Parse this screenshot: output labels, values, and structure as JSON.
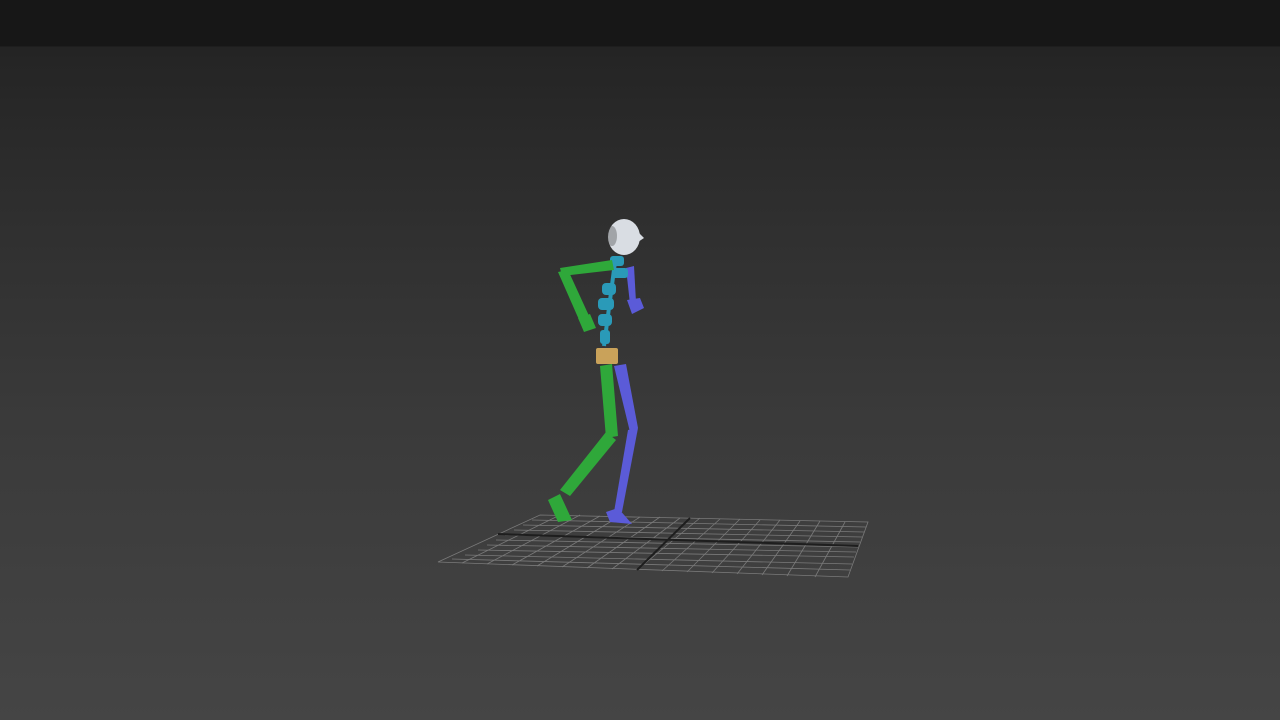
{
  "viewport": {
    "background_top": "#171717",
    "background_bottom": "#454545"
  },
  "scene": {
    "objects": [
      {
        "name": "ground-grid",
        "color": "#8a8a8a"
      },
      {
        "name": "biped",
        "parts": {
          "head": "#d9dde3",
          "spine": "#2a9ab8",
          "pelvis": "#c9a25a",
          "left_limbs": "#2fa83a",
          "right_limbs": "#5a5ad6"
        }
      }
    ]
  }
}
